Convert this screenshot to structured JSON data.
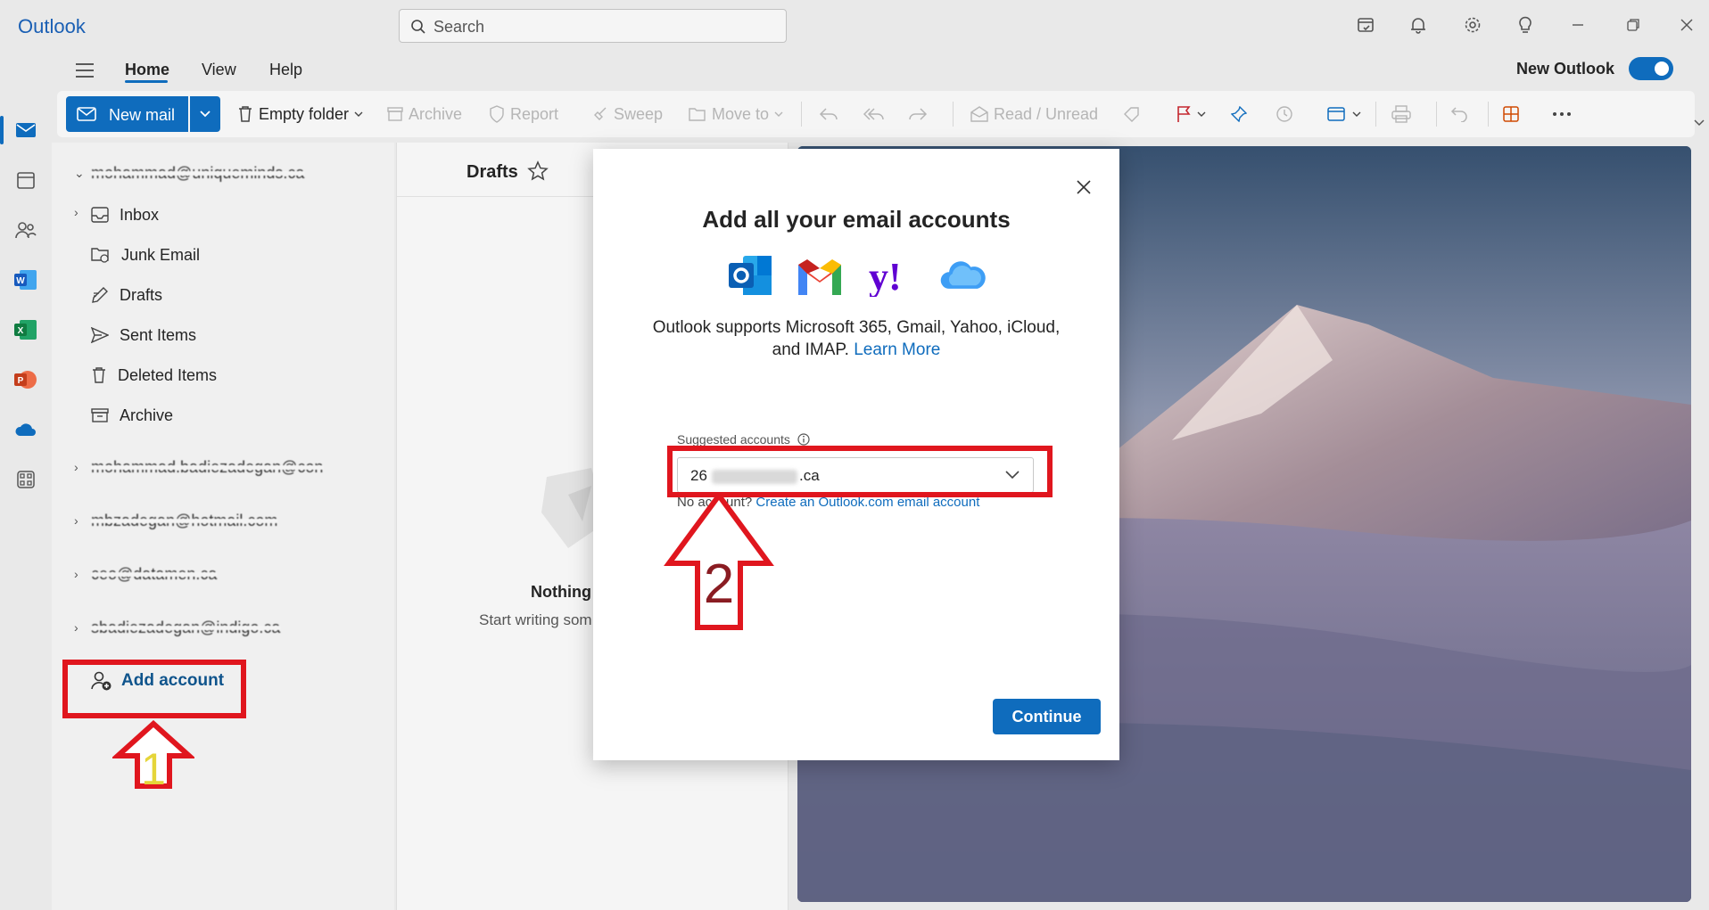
{
  "app": {
    "name": "Outlook"
  },
  "search": {
    "placeholder": "Search"
  },
  "titlebar_icons": [
    "my-day-icon",
    "bell-icon",
    "gear-icon",
    "lightbulb-icon",
    "minimize-icon",
    "restore-icon",
    "close-icon"
  ],
  "rail": {
    "items": [
      "mail-icon",
      "calendar-icon",
      "people-icon",
      "word-icon",
      "excel-icon",
      "powerpoint-icon",
      "onedrive-icon",
      "apps-icon"
    ]
  },
  "tabs": [
    {
      "label": "Home",
      "active": true
    },
    {
      "label": "View",
      "active": false
    },
    {
      "label": "Help",
      "active": false
    }
  ],
  "new_outlook": {
    "label": "New Outlook",
    "enabled": true
  },
  "ribbon": {
    "new_mail": "New mail",
    "empty_folder": "Empty folder",
    "archive": "Archive",
    "report": "Report",
    "sweep": "Sweep",
    "move_to": "Move to",
    "read_unread": "Read / Unread"
  },
  "folders": {
    "account_1": "mohammad@uniqueminds.ca",
    "items": [
      {
        "label": "Inbox"
      },
      {
        "label": "Junk Email"
      },
      {
        "label": "Drafts"
      },
      {
        "label": "Sent Items"
      },
      {
        "label": "Deleted Items"
      },
      {
        "label": "Archive"
      }
    ],
    "other_accounts": [
      "mohammad.badiezadegan@con",
      "mbzadegan@hotmail.com",
      "ceo@datamen.ca",
      "sbadiezadegan@indigo.ca"
    ],
    "add_account": "Add account"
  },
  "message_list": {
    "title": "Drafts",
    "empty_title": "Nothing",
    "empty_subtitle": "Start writing som"
  },
  "dialog": {
    "title": "Add all your email accounts",
    "description": "Outlook supports Microsoft 365, Gmail, Yahoo, iCloud, and IMAP.",
    "learn_more": "Learn More",
    "suggested_label": "Suggested accounts",
    "suggested_value_prefix": "26",
    "suggested_value_suffix": ".ca",
    "no_account_prefix": "No account?",
    "no_account_link": "Create an Outlook.com email account",
    "continue": "Continue"
  },
  "annotations": {
    "step1": "1",
    "step2": "2"
  },
  "colors": {
    "accent": "#0f6cbd",
    "highlight": "#e0161e",
    "step1_digit": "#e5d53a",
    "step2_digit": "#8a1c22"
  }
}
